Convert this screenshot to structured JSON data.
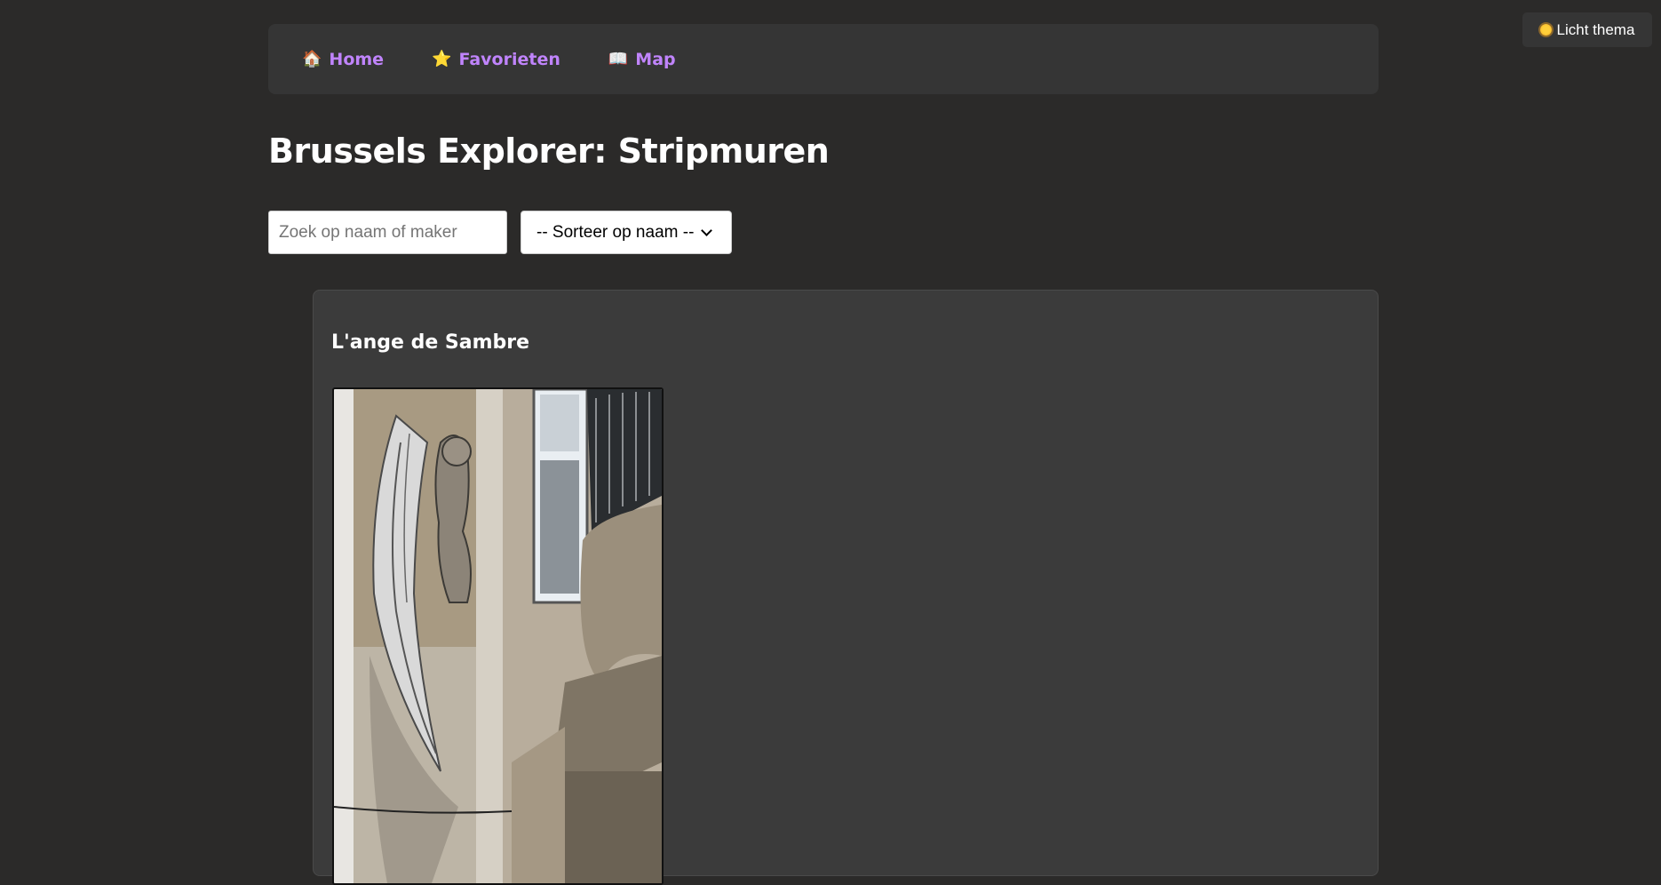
{
  "theme_toggle": {
    "label": "Licht thema",
    "icon": "sun-icon"
  },
  "nav": {
    "items": [
      {
        "label": "Home",
        "icon": "🏠",
        "icon_name": "house-icon"
      },
      {
        "label": "Favorieten",
        "icon": "⭐",
        "icon_name": "star-icon"
      },
      {
        "label": "Map",
        "icon": "📖",
        "icon_name": "map-book-icon"
      }
    ]
  },
  "page": {
    "title": "Brussels Explorer: Stripmuren"
  },
  "search": {
    "placeholder": "Zoek op naam of maker",
    "value": ""
  },
  "sort": {
    "selected": "-- Sorteer op naam --"
  },
  "cards": [
    {
      "title": "L'ange de Sambre"
    }
  ],
  "colors": {
    "background": "#2b2a29",
    "panel": "#353535",
    "card": "#3b3b3b",
    "nav_link": "#c084fc",
    "text": "#ffffff"
  }
}
